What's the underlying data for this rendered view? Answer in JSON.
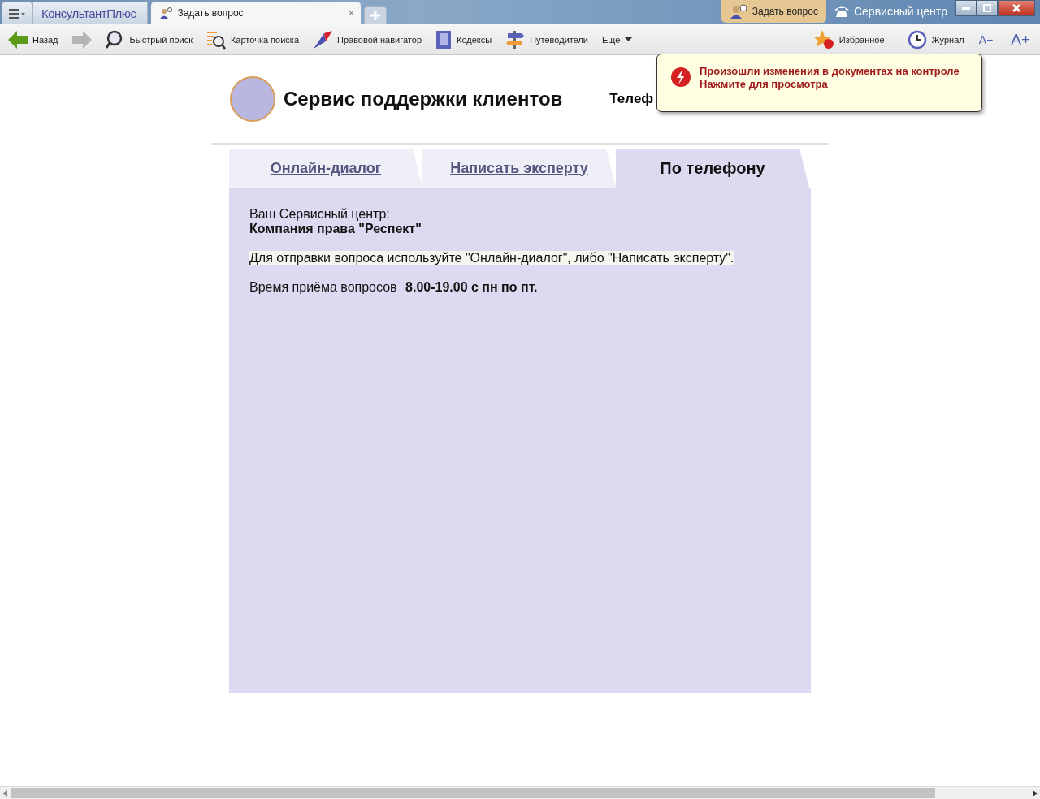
{
  "title_bar": {
    "brand": "КонсультантПлюс",
    "tabs": [
      {
        "label": "Задать вопрос",
        "close": "×",
        "selected": true
      }
    ],
    "ask_button": "Задать вопрос",
    "service_button": "Сервисный центр"
  },
  "toolbar": {
    "items": [
      {
        "kind": "back",
        "label": "Назад"
      },
      {
        "kind": "forward"
      },
      {
        "kind": "search",
        "label": "Быстрый поиск"
      },
      {
        "kind": "card",
        "label": "Карточка поиска"
      },
      {
        "kind": "navigator",
        "label": "Правовой навигатор"
      },
      {
        "kind": "codes",
        "label": "Кодексы"
      },
      {
        "kind": "guides",
        "label": "Путеводители"
      },
      {
        "kind": "more",
        "label": "Еще"
      }
    ],
    "right_items": [
      {
        "kind": "favorites",
        "label": "Избранное"
      },
      {
        "kind": "journal",
        "label": "Журнал"
      },
      {
        "kind": "font-down",
        "label": "A−"
      },
      {
        "kind": "font-up",
        "label": "A+"
      }
    ]
  },
  "notification": {
    "lines": [
      "Произошли изменения в документах на контроле",
      "Нажмите для просмотра"
    ]
  },
  "header": {
    "title": "Сервис поддержки клиентов",
    "phone_label": "Телеф"
  },
  "tabs": [
    {
      "label": "Онлайн-диалог",
      "selected": false
    },
    {
      "label": "Написать эксперту",
      "selected": false
    },
    {
      "label": "По телефону",
      "selected": true
    }
  ],
  "panel": {
    "center_label": "Ваш Сервисный центр:",
    "center_name": "Компания права \"Респект\"",
    "hint": "Для отправки вопроса используйте \"Онлайн-диалог\", либо \"Написать эксперту\".",
    "hours_label": "Время приёма вопросов",
    "hours": "8.00-19.00 с пн по пт."
  }
}
